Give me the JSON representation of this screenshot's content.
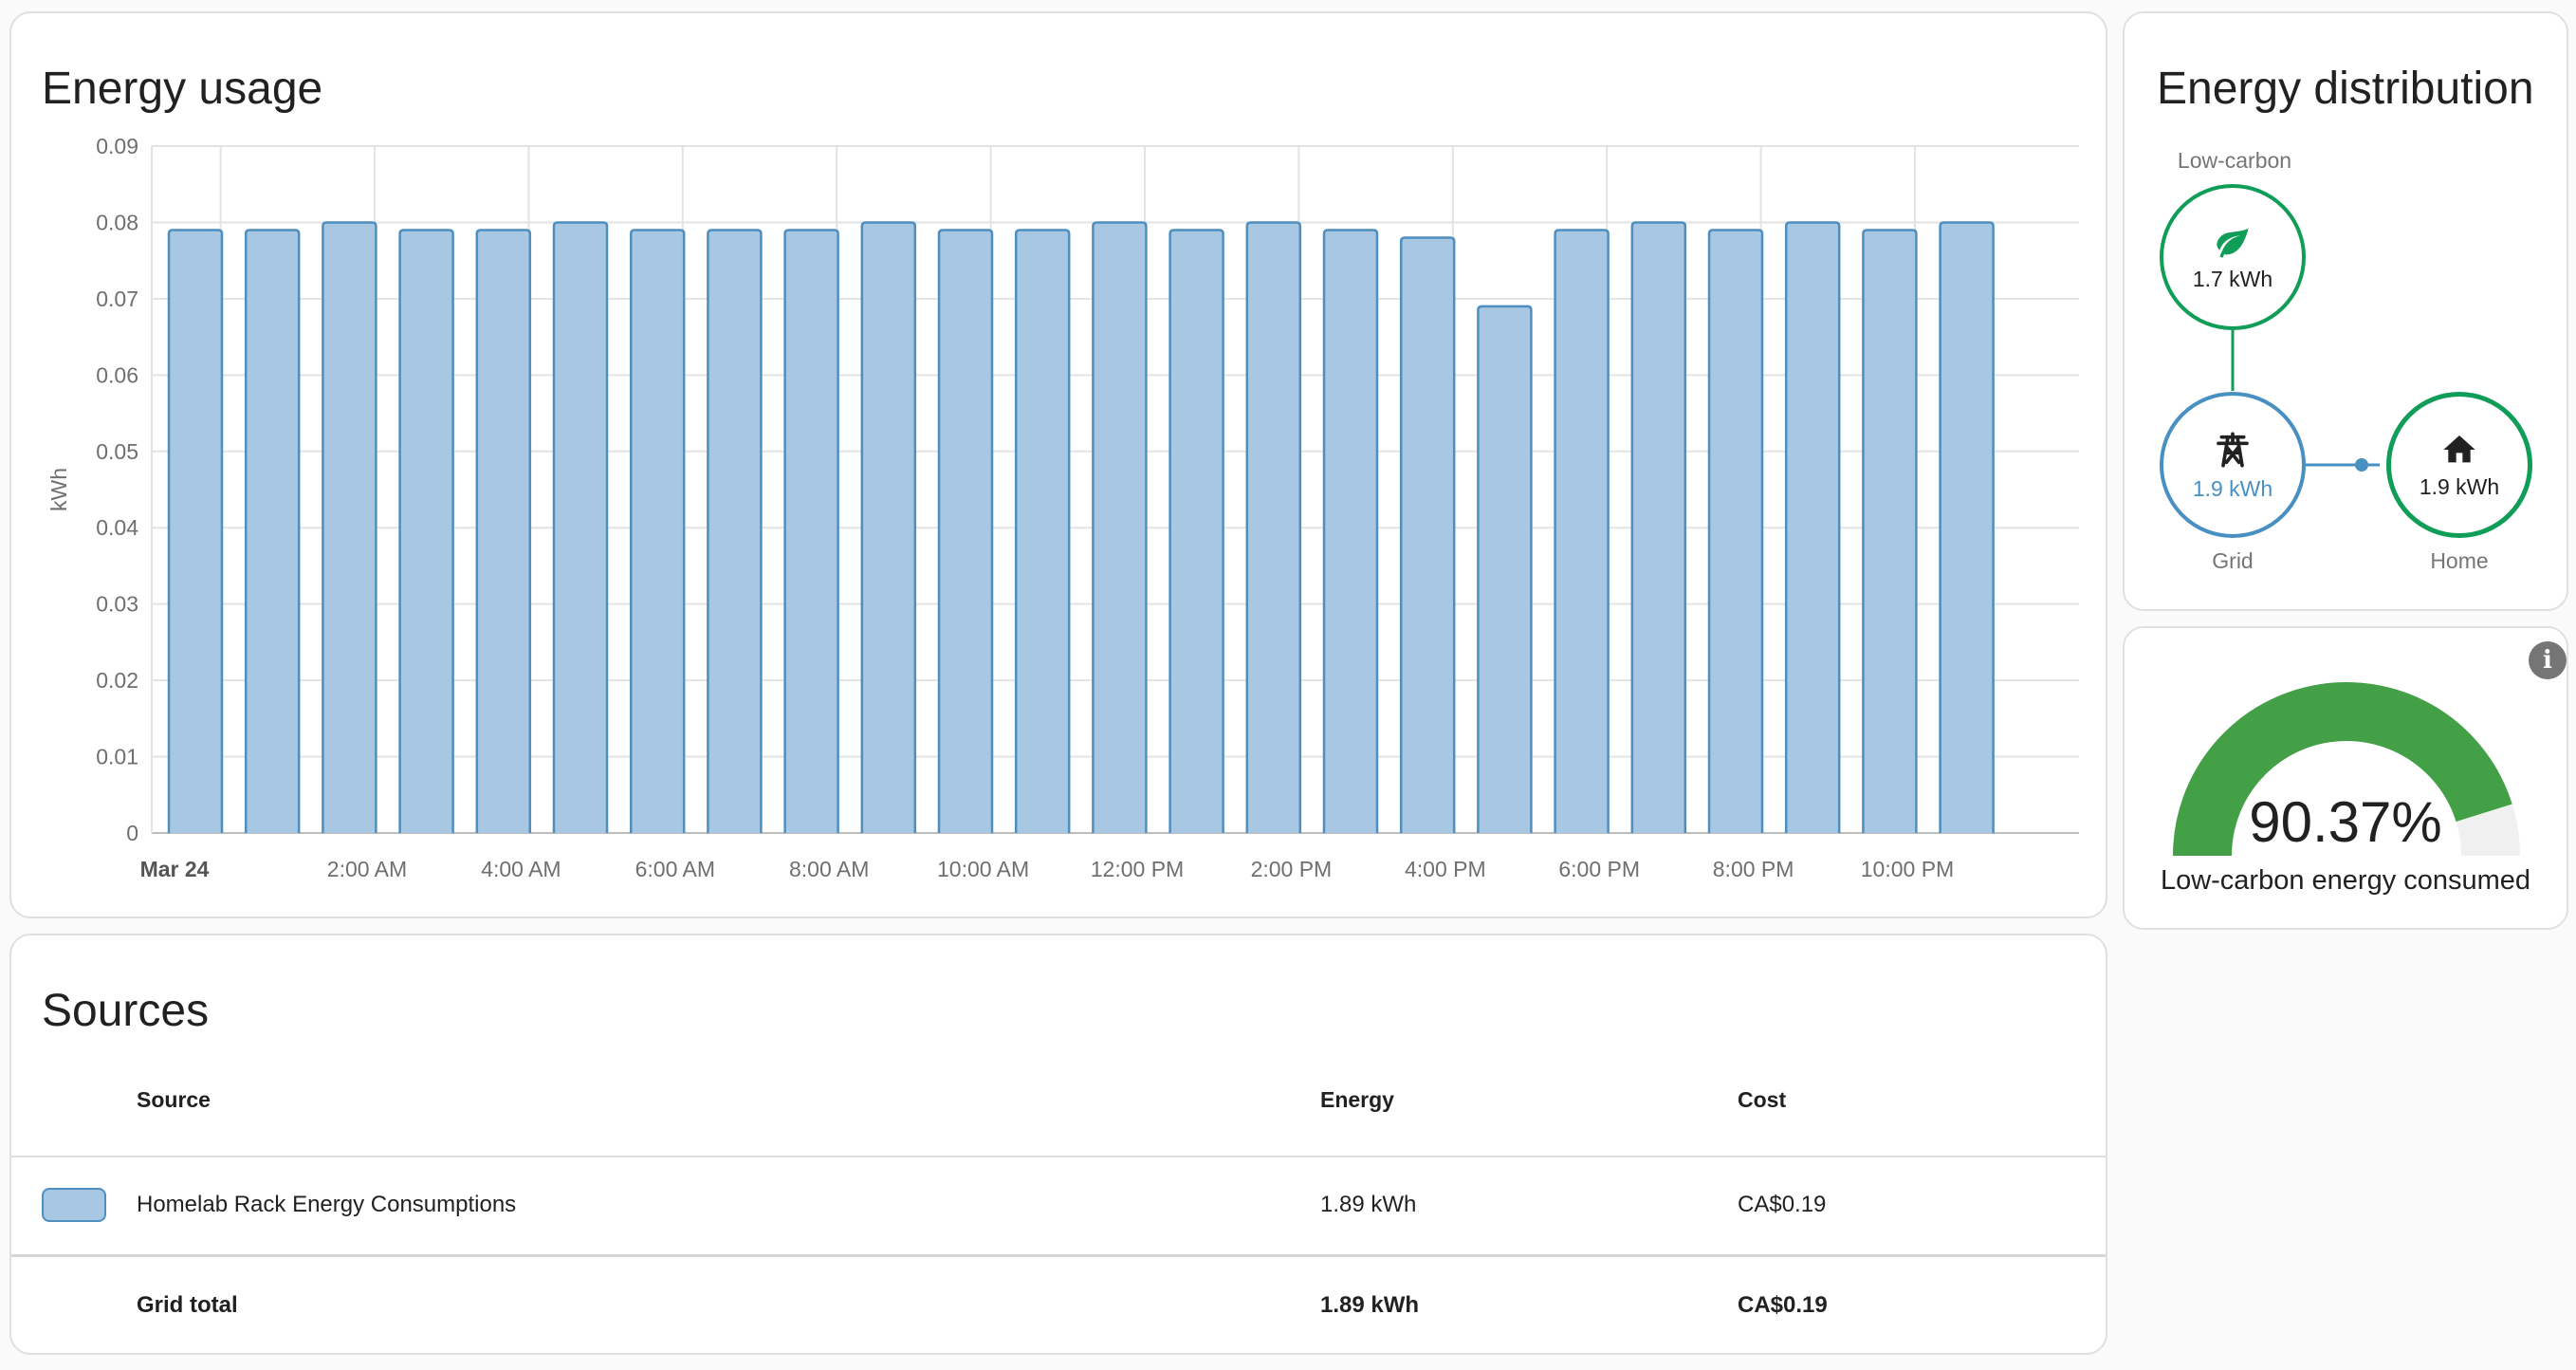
{
  "usage": {
    "title": "Energy usage",
    "chart_data": {
      "type": "bar",
      "title": "",
      "xlabel": "",
      "ylabel": "kWh",
      "ylim": [
        0,
        0.09
      ],
      "yticks": [
        "0",
        "0.01",
        "0.02",
        "0.03",
        "0.04",
        "0.05",
        "0.06",
        "0.07",
        "0.08",
        "0.09"
      ],
      "xticks": [
        "Mar 24",
        "2:00 AM",
        "4:00 AM",
        "6:00 AM",
        "8:00 AM",
        "10:00 AM",
        "12:00 PM",
        "2:00 PM",
        "4:00 PM",
        "6:00 PM",
        "8:00 PM",
        "10:00 PM"
      ],
      "grid": true,
      "bar_color": "#a7c7e3",
      "bar_edge_color": "#4f8fbf",
      "values": [
        0.079,
        0.079,
        0.08,
        0.079,
        0.079,
        0.08,
        0.079,
        0.079,
        0.079,
        0.08,
        0.079,
        0.079,
        0.08,
        0.079,
        0.08,
        0.079,
        0.078,
        0.069,
        0.079,
        0.08,
        0.079,
        0.08,
        0.079,
        0.08
      ]
    }
  },
  "distribution": {
    "title": "Energy distribution",
    "low_carbon": {
      "label": "Low-carbon",
      "value": "1.7 kWh",
      "color": "#0f9d58"
    },
    "grid": {
      "label": "Grid",
      "value": "1.9 kWh",
      "color": "#488fc2"
    },
    "home": {
      "label": "Home",
      "value": "1.9 kWh",
      "color": "#0f9d58"
    }
  },
  "gauge": {
    "value": "90.37%",
    "fraction": 0.9037,
    "label": "Low-carbon energy consumed",
    "color": "#43a047"
  },
  "sources": {
    "title": "Sources",
    "columns": {
      "source": "Source",
      "energy": "Energy",
      "cost": "Cost"
    },
    "rows": [
      {
        "name": "Homelab Rack Energy Consumptions",
        "energy": "1.89 kWh",
        "cost": "CA$0.19"
      }
    ],
    "total": {
      "name": "Grid total",
      "energy": "1.89 kWh",
      "cost": "CA$0.19"
    }
  }
}
